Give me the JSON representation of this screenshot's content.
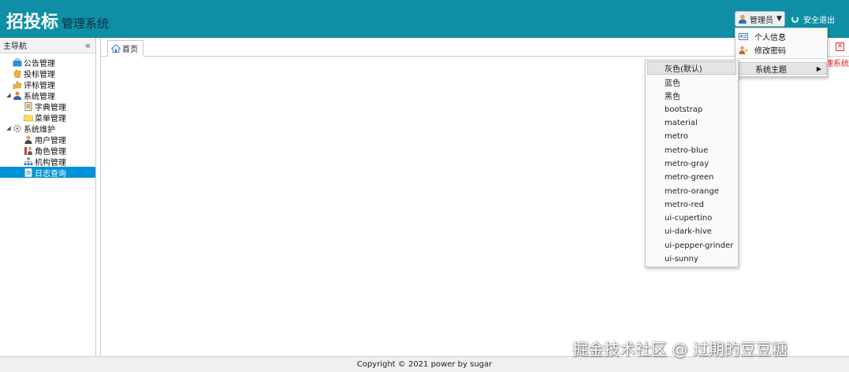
{
  "header": {
    "title": "招投标",
    "subtitle": "管理系统",
    "user_label": "管理员",
    "logout_label": "安全退出"
  },
  "sidebar": {
    "title": "主导航",
    "nodes": [
      {
        "label": "公告管理",
        "icon": "briefcase-icon"
      },
      {
        "label": "投标管理",
        "icon": "hand-icon"
      },
      {
        "label": "评标管理",
        "icon": "thumbs-up-icon"
      },
      {
        "label": "系统管理",
        "icon": "user-group-icon"
      },
      {
        "label": "字典管理",
        "icon": "document-icon"
      },
      {
        "label": "菜单管理",
        "icon": "folder-icon"
      },
      {
        "label": "系统维护",
        "icon": "gear-icon"
      },
      {
        "label": "用户管理",
        "icon": "user-icon"
      },
      {
        "label": "角色管理",
        "icon": "role-icon"
      },
      {
        "label": "机构管理",
        "icon": "org-chart-icon"
      },
      {
        "label": "日志查询",
        "icon": "log-icon"
      }
    ]
  },
  "main": {
    "tab_label": "首页",
    "side_label": "理系统"
  },
  "user_menu": {
    "items": [
      "个人信息",
      "修改密码",
      "系统主题"
    ]
  },
  "theme_menu": {
    "items": [
      "灰色(默认)",
      "蓝色",
      "黑色",
      "bootstrap",
      "material",
      "metro",
      "metro-blue",
      "metro-gray",
      "metro-green",
      "metro-orange",
      "metro-red",
      "ui-cupertino",
      "ui-dark-hive",
      "ui-pepper-grinder",
      "ui-sunny"
    ]
  },
  "footer": {
    "text": "Copyright © 2021 power by sugar"
  },
  "watermark": "掘金技术社区 @ 过期的豆豆糖",
  "colors": {
    "header_bg": "#0f8fa6",
    "selected_bg": "#0092d6",
    "close_red": "#d33"
  }
}
